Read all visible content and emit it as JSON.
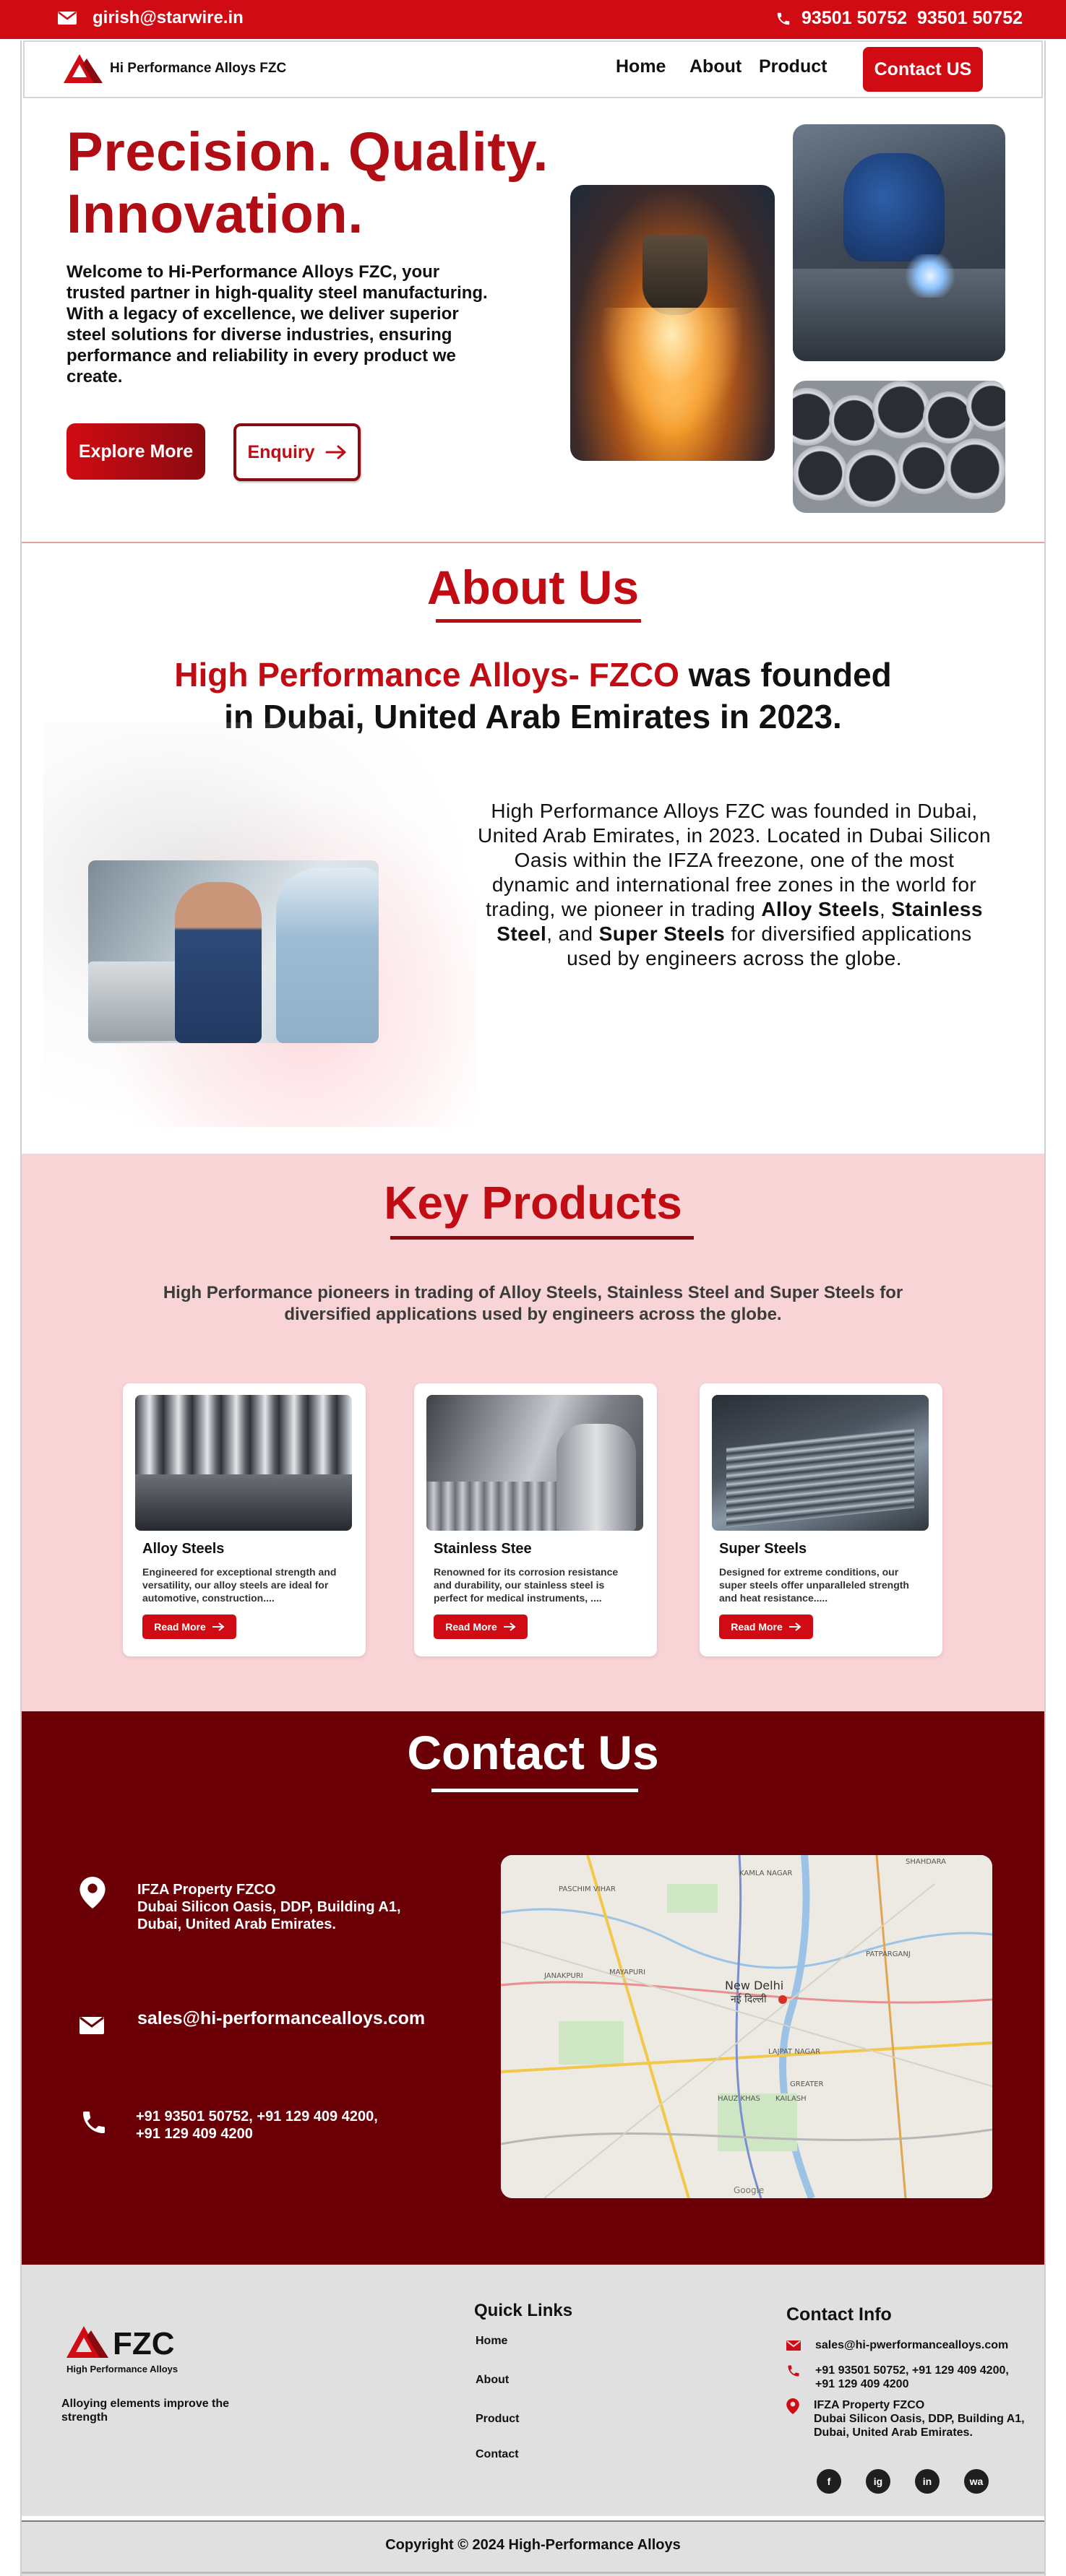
{
  "topbar": {
    "email": "girish@starwire.in",
    "phone1": "93501 50752",
    "phone2": "93501 50752"
  },
  "nav": {
    "logo_text": "Hi Performance Alloys FZC",
    "links": [
      "Home",
      "About",
      "Product"
    ],
    "contact_button": "Contact US"
  },
  "hero": {
    "title_line1": "Precision. Quality.",
    "title_line2": "Innovation.",
    "description": "Welcome to Hi-Performance Alloys FZC, your trusted partner in high-quality steel manufacturing. With a legacy of excellence, we deliver superior steel solutions for diverse industries, ensuring performance and reliability in every product we create.",
    "explore_button": "Explore More",
    "enquiry_button": "Enquiry"
  },
  "about": {
    "title": "About Us",
    "lead_red": "High Performance Alloys- FZCO",
    "lead_rest1": " was founded",
    "lead_rest2": "in Dubai, United Arab Emirates in 2023.",
    "para_part1": "High Performance Alloys FZC was founded in Dubai, United Arab Emirates, in 2023. Located in Dubai Silicon Oasis within the IFZA freezone, one of the most dynamic and international free zones in the world for trading, we pioneer in trading ",
    "bold1": "Alloy Steels",
    "sep1": ", ",
    "bold2": "Stainless Steel",
    "sep2": ", and ",
    "bold3": "Super Steels",
    "para_part2": " for diversified applications used by engineers across the globe."
  },
  "products": {
    "title": "Key Products",
    "description": "High Performance pioneers in trading of Alloy Steels, Stainless Steel and Super Steels for diversified applications used by engineers across the globe.",
    "items": [
      {
        "name": "Alloy Steels",
        "text": "Engineered for exceptional strength and versatility, our alloy steels are ideal for automotive, construction....",
        "button": "Read More"
      },
      {
        "name": "Stainless Stee",
        "text": "Renowned for its corrosion resistance and durability, our stainless steel is perfect for medical instruments, ....",
        "button": "Read More"
      },
      {
        "name": "Super Steels",
        "text": "Designed for extreme conditions, our super steels offer unparalleled strength and heat resistance.....",
        "button": "Read More"
      }
    ]
  },
  "contact": {
    "title": "Contact Us",
    "address": "IFZA Property FZCO\nDubai Silicon Oasis, DDP, Building A1,\nDubai, United Arab Emirates.",
    "email": "sales@hi-performancealloys.com",
    "phone": "+91 93501 50752, +91 129 409 4200,\n+91 129 409 4200",
    "map_labels": {
      "city": "New Delhi",
      "city_hi": "नई दिल्ली",
      "l1": "KAMLA NAGAR",
      "l2": "PASCHIM VIHAR",
      "l3": "JANAKPURI",
      "l4": "MAYAPURI",
      "l5": "PATPARGANJ",
      "l6": "LAJPAT NAGAR",
      "l7": "HAUZ KHAS",
      "l8": "KAILASH",
      "l9": "SHAHDARA",
      "l10": "GREATER",
      "l11": "Google"
    }
  },
  "footer": {
    "brand": "FZC",
    "brand_sub": "High Performance Alloys",
    "tagline": "Alloying elements improve the strength",
    "quick_links_title": "Quick Links",
    "quick_links": [
      "Home",
      "About",
      "Product",
      "Contact"
    ],
    "contact_info_title": "Contact Info",
    "email": "sales@hi-pwerformancealloys.com",
    "phone": "+91 93501 50752, +91 129 409 4200,\n+91 129 409 4200",
    "address": "IFZA Property FZCO\nDubai Silicon Oasis, DDP, Building A1,\nDubai, United Arab Emirates.",
    "social": [
      "f",
      "ig",
      "in",
      "wa"
    ],
    "copyright": "Copyright © 2024 High-Performance Alloys"
  },
  "colors": {
    "brand_red": "#d10b13",
    "dark_red": "#6b0107",
    "pink": "#f9d4d6",
    "footer_gray": "#e0e0e0"
  }
}
